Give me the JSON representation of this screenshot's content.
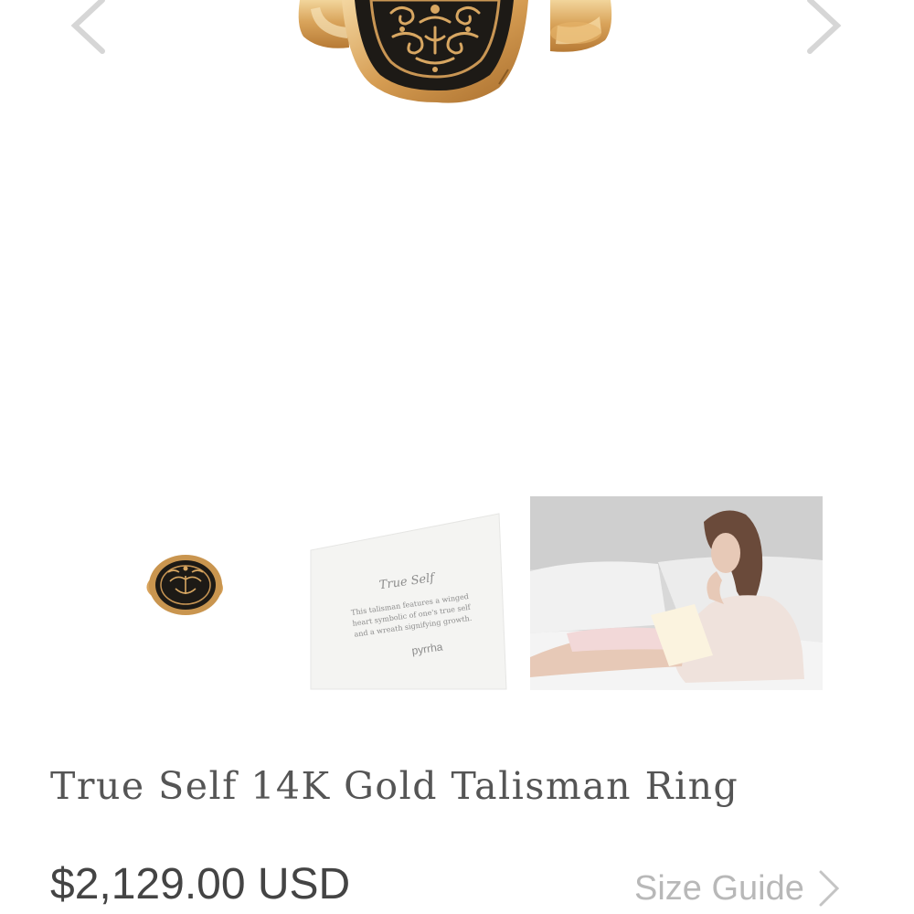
{
  "product": {
    "title": "True Self 14K Gold Talisman Ring",
    "price": "$2,129.00 USD",
    "size_guide_label": "Size Guide"
  },
  "gallery": {
    "prev_icon": "chevron-left-icon",
    "next_icon": "chevron-right-icon",
    "thumbnails": [
      {
        "name": "ring-thumbnail"
      },
      {
        "name": "card-thumbnail",
        "card_title": "True Self",
        "card_text_line1": "This talisman features a winged",
        "card_text_line2": "heart symbolic of one's true self",
        "card_text_line3": "and a wreath signifying growth.",
        "card_brand": "pyrrha"
      },
      {
        "name": "lifestyle-thumbnail"
      }
    ]
  },
  "colors": {
    "gold": "#c9954f",
    "gold_light": "#e4bd7d",
    "enamel": "#1d1a16",
    "text": "#555555",
    "muted": "#b8b8b8"
  }
}
